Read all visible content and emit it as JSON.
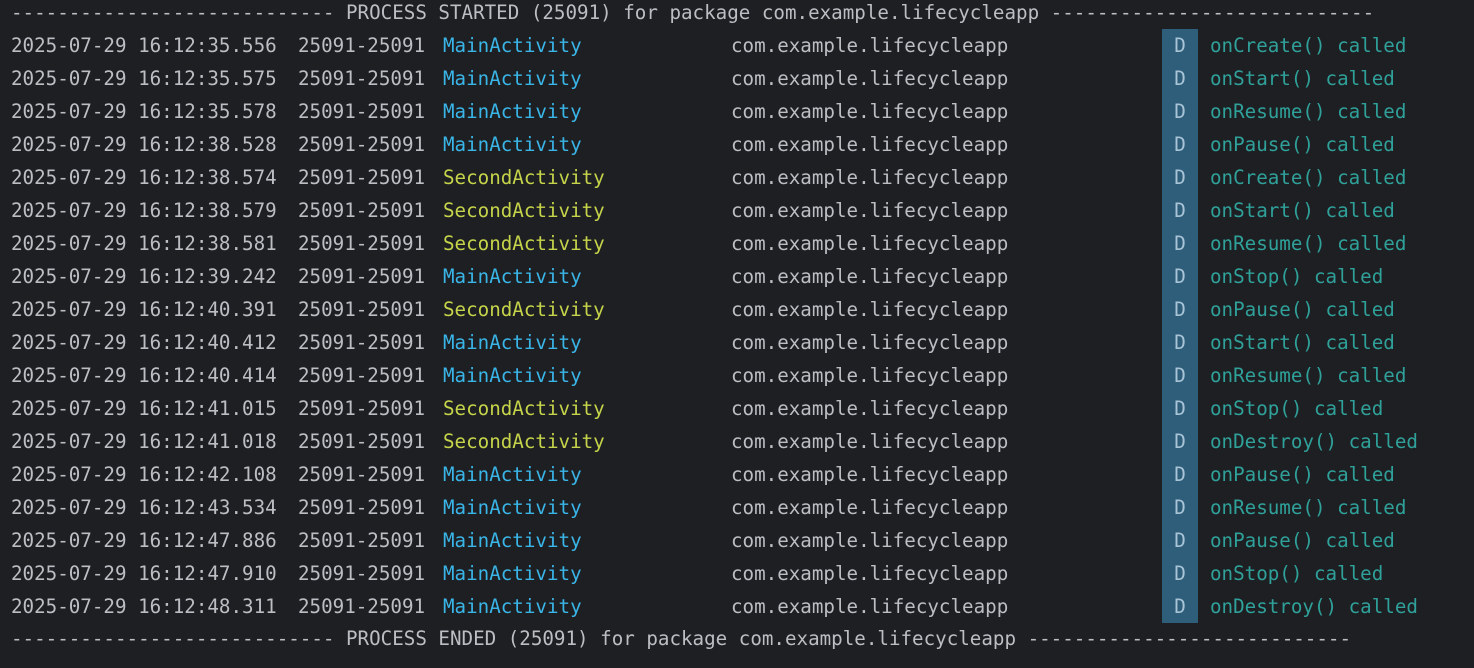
{
  "header_separator": "---------------------------- PROCESS STARTED (25091) for package com.example.lifecycleapp ----------------------------",
  "footer_separator": "---------------------------- PROCESS ENDED (25091) for package com.example.lifecycleapp ----------------------------",
  "colors": {
    "background": "#1e1f22",
    "text": "#bcbec4",
    "main_activity_tag": "#3ab5e8",
    "second_activity_tag": "#c5d44a",
    "debug_level_bg": "#2e5e7a",
    "message": "#2fa19a"
  },
  "rows": [
    {
      "timestamp": "2025-07-29 16:12:35.556",
      "pid": "25091-25091",
      "tag": "MainActivity",
      "package": "com.example.lifecycleapp",
      "level": "D",
      "message": "onCreate() called"
    },
    {
      "timestamp": "2025-07-29 16:12:35.575",
      "pid": "25091-25091",
      "tag": "MainActivity",
      "package": "com.example.lifecycleapp",
      "level": "D",
      "message": "onStart() called"
    },
    {
      "timestamp": "2025-07-29 16:12:35.578",
      "pid": "25091-25091",
      "tag": "MainActivity",
      "package": "com.example.lifecycleapp",
      "level": "D",
      "message": "onResume() called"
    },
    {
      "timestamp": "2025-07-29 16:12:38.528",
      "pid": "25091-25091",
      "tag": "MainActivity",
      "package": "com.example.lifecycleapp",
      "level": "D",
      "message": "onPause() called"
    },
    {
      "timestamp": "2025-07-29 16:12:38.574",
      "pid": "25091-25091",
      "tag": "SecondActivity",
      "package": "com.example.lifecycleapp",
      "level": "D",
      "message": "onCreate() called"
    },
    {
      "timestamp": "2025-07-29 16:12:38.579",
      "pid": "25091-25091",
      "tag": "SecondActivity",
      "package": "com.example.lifecycleapp",
      "level": "D",
      "message": "onStart() called"
    },
    {
      "timestamp": "2025-07-29 16:12:38.581",
      "pid": "25091-25091",
      "tag": "SecondActivity",
      "package": "com.example.lifecycleapp",
      "level": "D",
      "message": "onResume() called"
    },
    {
      "timestamp": "2025-07-29 16:12:39.242",
      "pid": "25091-25091",
      "tag": "MainActivity",
      "package": "com.example.lifecycleapp",
      "level": "D",
      "message": "onStop() called"
    },
    {
      "timestamp": "2025-07-29 16:12:40.391",
      "pid": "25091-25091",
      "tag": "SecondActivity",
      "package": "com.example.lifecycleapp",
      "level": "D",
      "message": "onPause() called"
    },
    {
      "timestamp": "2025-07-29 16:12:40.412",
      "pid": "25091-25091",
      "tag": "MainActivity",
      "package": "com.example.lifecycleapp",
      "level": "D",
      "message": "onStart() called"
    },
    {
      "timestamp": "2025-07-29 16:12:40.414",
      "pid": "25091-25091",
      "tag": "MainActivity",
      "package": "com.example.lifecycleapp",
      "level": "D",
      "message": "onResume() called"
    },
    {
      "timestamp": "2025-07-29 16:12:41.015",
      "pid": "25091-25091",
      "tag": "SecondActivity",
      "package": "com.example.lifecycleapp",
      "level": "D",
      "message": "onStop() called"
    },
    {
      "timestamp": "2025-07-29 16:12:41.018",
      "pid": "25091-25091",
      "tag": "SecondActivity",
      "package": "com.example.lifecycleapp",
      "level": "D",
      "message": "onDestroy() called"
    },
    {
      "timestamp": "2025-07-29 16:12:42.108",
      "pid": "25091-25091",
      "tag": "MainActivity",
      "package": "com.example.lifecycleapp",
      "level": "D",
      "message": "onPause() called"
    },
    {
      "timestamp": "2025-07-29 16:12:43.534",
      "pid": "25091-25091",
      "tag": "MainActivity",
      "package": "com.example.lifecycleapp",
      "level": "D",
      "message": "onResume() called"
    },
    {
      "timestamp": "2025-07-29 16:12:47.886",
      "pid": "25091-25091",
      "tag": "MainActivity",
      "package": "com.example.lifecycleapp",
      "level": "D",
      "message": "onPause() called"
    },
    {
      "timestamp": "2025-07-29 16:12:47.910",
      "pid": "25091-25091",
      "tag": "MainActivity",
      "package": "com.example.lifecycleapp",
      "level": "D",
      "message": "onStop() called"
    },
    {
      "timestamp": "2025-07-29 16:12:48.311",
      "pid": "25091-25091",
      "tag": "MainActivity",
      "package": "com.example.lifecycleapp",
      "level": "D",
      "message": "onDestroy() called"
    }
  ]
}
